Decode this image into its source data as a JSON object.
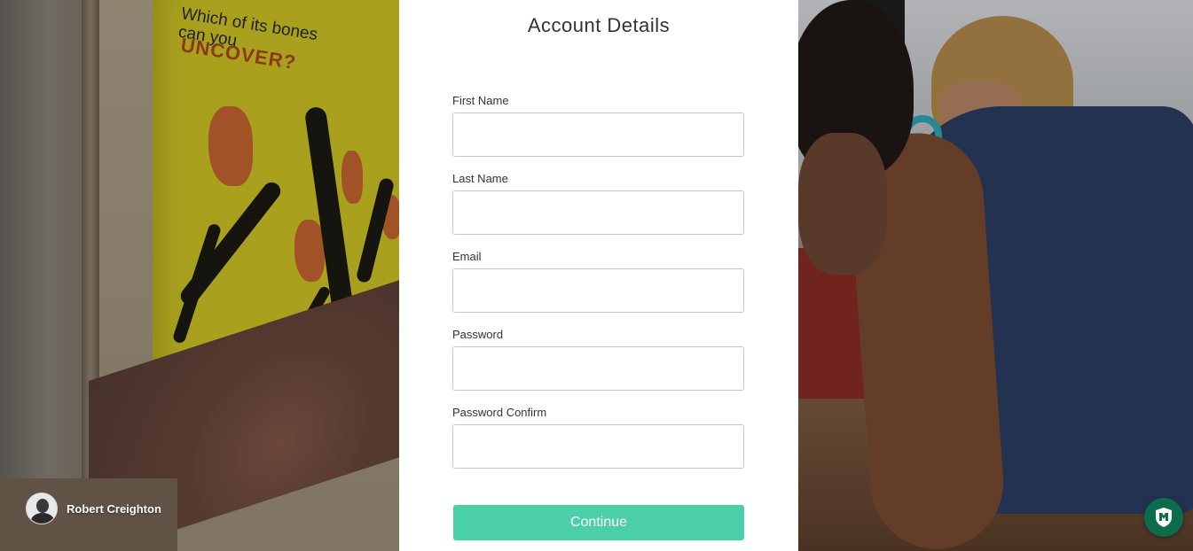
{
  "form": {
    "title": "Account Details",
    "fields": [
      {
        "label": "First Name",
        "value": "",
        "placeholder": ""
      },
      {
        "label": "Last Name",
        "value": "",
        "placeholder": ""
      },
      {
        "label": "Email",
        "value": "",
        "placeholder": ""
      },
      {
        "label": "Password",
        "value": "",
        "placeholder": ""
      },
      {
        "label": "Password Confirm",
        "value": "",
        "placeholder": ""
      }
    ],
    "continue_label": "Continue"
  },
  "photo_credit": {
    "name": "Robert Creighton"
  },
  "background_left": {
    "sign_heading": "Which of its bones can you",
    "sign_emphasis": "UNCOVER?"
  },
  "security_badge": {
    "icon": "shield-m-icon"
  },
  "colors": {
    "accent": "#4bcfa8",
    "badge": "#0d6b4e",
    "title_text": "#333333"
  }
}
